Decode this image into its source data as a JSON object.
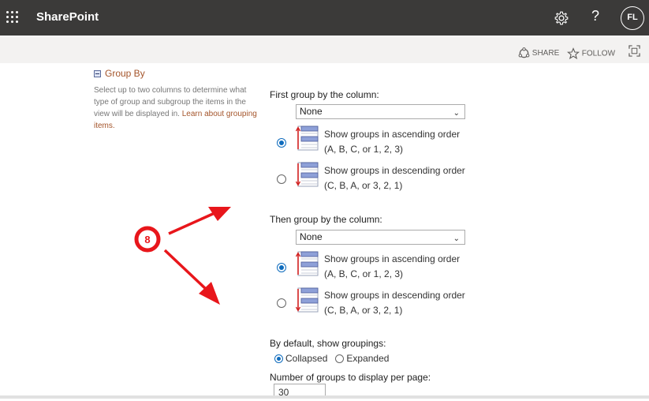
{
  "app": {
    "title": "SharePoint",
    "avatar_initials": "FL"
  },
  "topbar_icons": [
    "waffle-icon",
    "gear-icon",
    "help-icon"
  ],
  "commandbar": {
    "share": "SHARE",
    "follow": "FOLLOW"
  },
  "section": {
    "title": "Group By",
    "description": "Select up to two columns to determine what type of group and subgroup the items in the view will be displayed in.",
    "link": "Learn about grouping items."
  },
  "first_group": {
    "label": "First group by the column:",
    "selected": "None",
    "ascending_line1": "Show groups in ascending order",
    "ascending_line2": "(A, B, C, or 1, 2, 3)",
    "descending_line1": "Show groups in descending order",
    "descending_line2": "(C, B, A, or 3, 2, 1)",
    "selected_order": "ascending"
  },
  "second_group": {
    "label": "Then group by the column:",
    "selected": "None",
    "ascending_line1": "Show groups in ascending order",
    "ascending_line2": "(A, B, C, or 1, 2, 3)",
    "descending_line1": "Show groups in descending order",
    "descending_line2": "(C, B, A, or 3, 2, 1)",
    "selected_order": "ascending"
  },
  "default_groupings": {
    "label": "By default, show groupings:",
    "collapsed": "Collapsed",
    "expanded": "Expanded",
    "selected": "Collapsed"
  },
  "groups_per_page": {
    "label": "Number of groups to display per page:",
    "value": "30"
  },
  "annotation": {
    "badge": "8",
    "color": "#e8161b"
  }
}
